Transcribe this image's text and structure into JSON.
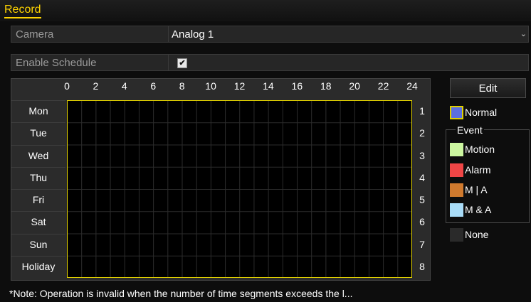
{
  "title": "Record",
  "camera": {
    "label": "Camera",
    "value": "Analog 1"
  },
  "enable_schedule": {
    "label": "Enable Schedule",
    "checked": true,
    "check_glyph": "✔"
  },
  "schedule": {
    "hours": [
      "0",
      "2",
      "4",
      "6",
      "8",
      "10",
      "12",
      "14",
      "16",
      "18",
      "20",
      "22",
      "24"
    ],
    "days": [
      "Mon",
      "Tue",
      "Wed",
      "Thu",
      "Fri",
      "Sat",
      "Sun",
      "Holiday"
    ],
    "row_numbers": [
      "1",
      "2",
      "3",
      "4",
      "5",
      "6",
      "7",
      "8"
    ]
  },
  "edit_button": "Edit",
  "legend": {
    "normal": {
      "label": "Normal",
      "color": "#5b6fe0"
    },
    "event_title": "Event",
    "motion": {
      "label": "Motion",
      "color": "#ccf7a0"
    },
    "alarm": {
      "label": "Alarm",
      "color": "#f04646"
    },
    "m_or_a": {
      "label": "M | A",
      "color": "#d07a2e"
    },
    "m_and_a": {
      "label": "M & A",
      "color": "#a9dcf7"
    },
    "none": {
      "label": "None",
      "color": "#2a2a2a"
    }
  },
  "note": "*Note: Operation is invalid when the number of time segments exceeds the l..."
}
